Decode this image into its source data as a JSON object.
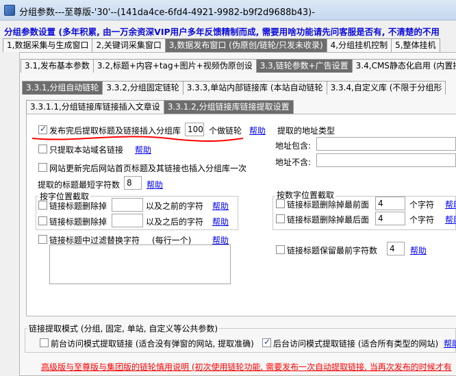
{
  "window": {
    "title": "分组参数---至尊版-'30'--(141da4ce-6fd4-4921-9982-b9f2d9688b43)-"
  },
  "banner": {
    "text_blue": "分组参数设置 (多年积累, 由一万余资深VIP用户多年反馈精制而成, 需要用啥功能请先问客服是否有, 不清楚的不用",
    "text_red": ""
  },
  "main_tabs": [
    {
      "label": "1,数据采集与生成窗口"
    },
    {
      "label": "2,关键词采集窗口"
    },
    {
      "label": "3,数据发布窗口 (伪原创/链轮/只发未收录)"
    },
    {
      "label": "4,分组挂机控制"
    },
    {
      "label": "5,整体挂机"
    }
  ],
  "sub_tabs": [
    {
      "label": "3.1,发布基本参数"
    },
    {
      "label": "3.2,标题+内容+tag+图片+视频伪原创设"
    },
    {
      "label": "3.3,链轮参数+广告设置"
    },
    {
      "label": "3.4,CMS静态化启用 (内置接"
    }
  ],
  "sub_sub_tabs": [
    {
      "label": "3.3.1,分组自动链轮"
    },
    {
      "label": "3.3.2,分组固定链轮"
    },
    {
      "label": "3.3.3,单站内部链接库 (本站自动链轮"
    },
    {
      "label": "3.3.4,自定义库 (不限于分组形"
    }
  ],
  "inner_tabs": [
    {
      "label": "3.3.1.1,分组链接库链接插入文章设"
    },
    {
      "label": "3.3.1.2,分组链接库链接提取设置"
    }
  ],
  "left": {
    "opt1": {
      "label": "发布完后提取标题及链接插入分组库",
      "value": "100",
      "suffix": "个做链轮",
      "help": "帮助"
    },
    "opt2": {
      "label": "只提取本站域名链接",
      "help": "帮助"
    },
    "opt3": {
      "label": "网站更新完后网站首页标题及其链接也插入分组库一次"
    },
    "min_title": {
      "label": "提取的标题最短字符数",
      "value": "8",
      "help": "帮助"
    },
    "char_group": {
      "title": "按字位置截取",
      "row1": {
        "label": "链接标题删除掉",
        "mid": "以及之前的字符",
        "help": "帮助"
      },
      "row2": {
        "label": "链接标题删除掉",
        "mid": "以及之后的字符",
        "help": "帮助"
      }
    },
    "filter": {
      "label": "链接标题中过滤替换字符",
      "note": "(每行一个)",
      "help": "帮助"
    }
  },
  "right": {
    "addr_group": {
      "title": "提取的地址类型",
      "include": "地址包含:",
      "exclude": "地址不含:"
    },
    "num_group": {
      "title": "按数字位置截取",
      "row1": {
        "label": "链接标题删除掉最前面",
        "value": "4",
        "unit": "个字符",
        "help": "帮助"
      },
      "row2": {
        "label": "链接标题删除掉最后面",
        "value": "4",
        "unit": "个字符",
        "help": "帮助"
      }
    },
    "keep": {
      "label": "链接标题保留最前字符数",
      "value": "4",
      "help": "帮助"
    }
  },
  "mode": {
    "title": "链接提取模式 (分组, 固定, 单站, 自定义等公共参数)",
    "front": "前台访问模式提取链接 (适合没有弹窗的网站, 提取准确)",
    "back": "后台访问模式提取链接 (适合所有类型的网站)",
    "help": "帮助"
  },
  "footer": {
    "text": "高级版与至尊版与集团版的链轮慎用说明 (初次使用链轮功能, 需要发布一次自动提取链接, 当再次发布的时候才有"
  },
  "colors": {
    "accent_blue": "#0a0adc",
    "link": "#0000ff",
    "red": "#ff0000",
    "tab_active": "#6d6d6d"
  }
}
